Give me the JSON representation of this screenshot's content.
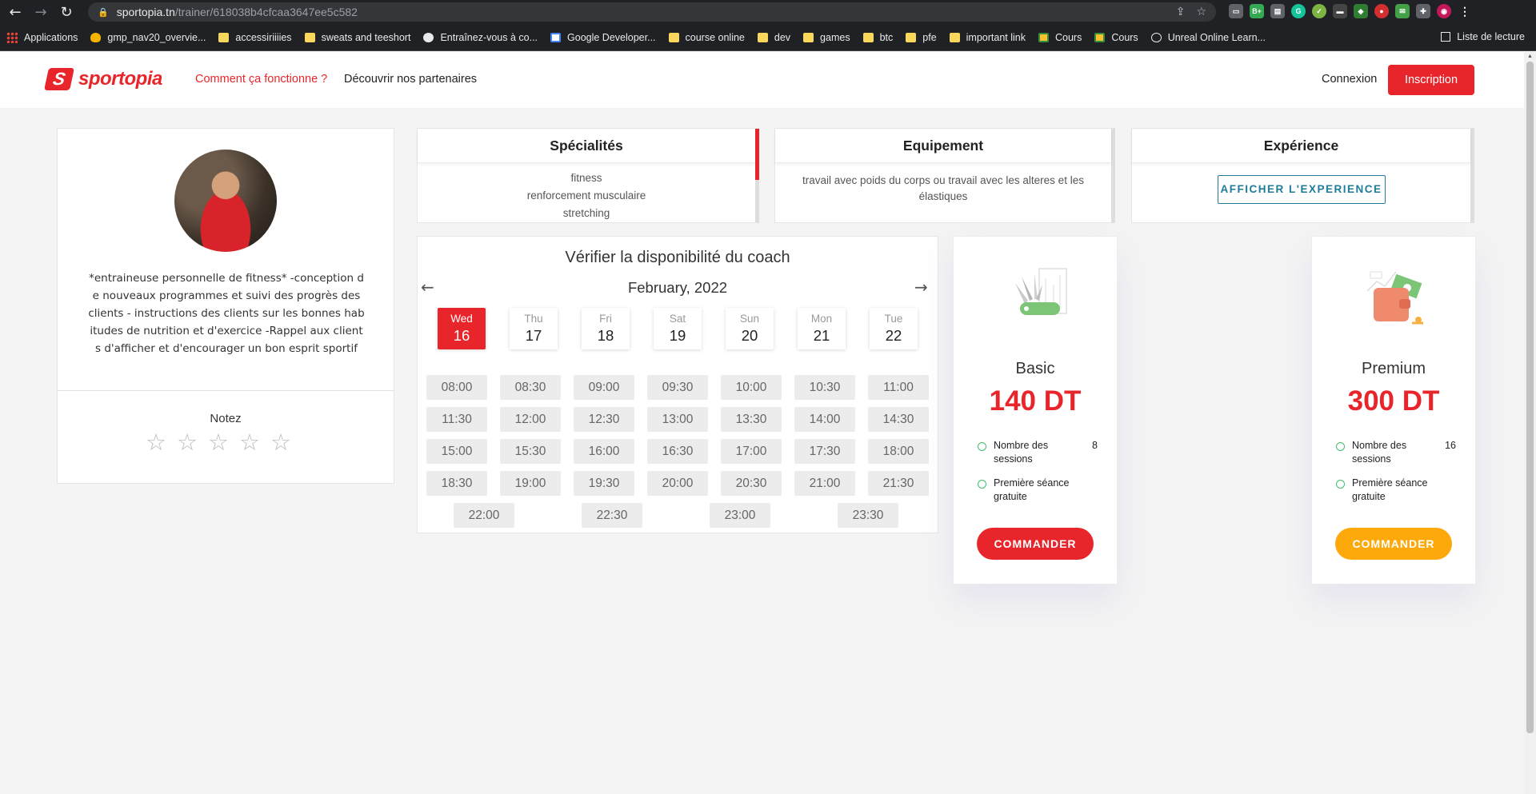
{
  "browser": {
    "url_host": "sportopia.tn",
    "url_path": "/trainer/618038b4cfcaa3647ee5c582",
    "bookmarks": [
      "Applications",
      "gmp_nav20_overvie...",
      "accessiriiiies",
      "sweats and teeshort",
      "Entraînez-vous à co...",
      "Google Developer...",
      "course online",
      "dev",
      "games",
      "btc",
      "pfe",
      "important link",
      "Cours",
      "Cours",
      "Unreal Online Learn..."
    ],
    "reading_list": "Liste de lecture"
  },
  "header": {
    "logo_text": "sportopia",
    "nav_how": "Comment ça fonctionne ?",
    "nav_partners": "Découvrir nos partenaires",
    "login": "Connexion",
    "signup": "Inscription"
  },
  "profile": {
    "bio": "*entraineuse personnelle de fitness* -conception de nouveaux programmes et suivi des progrès des clients - instructions des clients sur les bonnes habitudes de nutrition et d'exercice -Rappel aux clients d'afficher et d'encourager un bon esprit sportif",
    "rate_label": "Notez",
    "rating": 0,
    "max_rating": 5
  },
  "specialties": {
    "title": "Spécialités",
    "items": [
      "fitness",
      "renforcement musculaire",
      "stretching"
    ]
  },
  "equipment": {
    "title": "Equipement",
    "text": "travail avec poids du corps ou travail avec les alteres et les élastiques"
  },
  "experience": {
    "title": "Expérience",
    "button": "AFFICHER L'EXPERIENCE"
  },
  "calendar": {
    "title": "Vérifier la disponibilité du coach",
    "month": "February, 2022",
    "days": [
      {
        "name": "Wed",
        "date": "16",
        "active": true
      },
      {
        "name": "Thu",
        "date": "17",
        "active": false
      },
      {
        "name": "Fri",
        "date": "18",
        "active": false
      },
      {
        "name": "Sat",
        "date": "19",
        "active": false
      },
      {
        "name": "Sun",
        "date": "20",
        "active": false
      },
      {
        "name": "Mon",
        "date": "21",
        "active": false
      },
      {
        "name": "Tue",
        "date": "22",
        "active": false
      }
    ],
    "slots": [
      "08:00",
      "08:30",
      "09:00",
      "09:30",
      "10:00",
      "10:30",
      "11:00",
      "11:30",
      "12:00",
      "12:30",
      "13:00",
      "13:30",
      "14:00",
      "14:30",
      "15:00",
      "15:30",
      "16:00",
      "16:30",
      "17:00",
      "17:30",
      "18:00",
      "18:30",
      "19:00",
      "19:30",
      "20:00",
      "20:30",
      "21:00",
      "21:30"
    ],
    "slots_last": [
      "22:00",
      "22:30",
      "23:00",
      "23:30"
    ]
  },
  "plans": [
    {
      "name": "Basic",
      "price": "140 DT",
      "feature1": "Nombre des sessions",
      "sessions": "8",
      "feature2": "Première séance gratuite",
      "button": "COMMANDER",
      "button_color": "#e8252b"
    },
    {
      "name": "Premium",
      "price": "300 DT",
      "feature1": "Nombre des sessions",
      "sessions": "16",
      "feature2": "Première séance gratuite",
      "button": "COMMANDER",
      "button_color": "#fda90c"
    }
  ],
  "colors": {
    "brand": "#e8252b",
    "accent_blue": "#1e7c9a",
    "premium": "#fda90c"
  }
}
